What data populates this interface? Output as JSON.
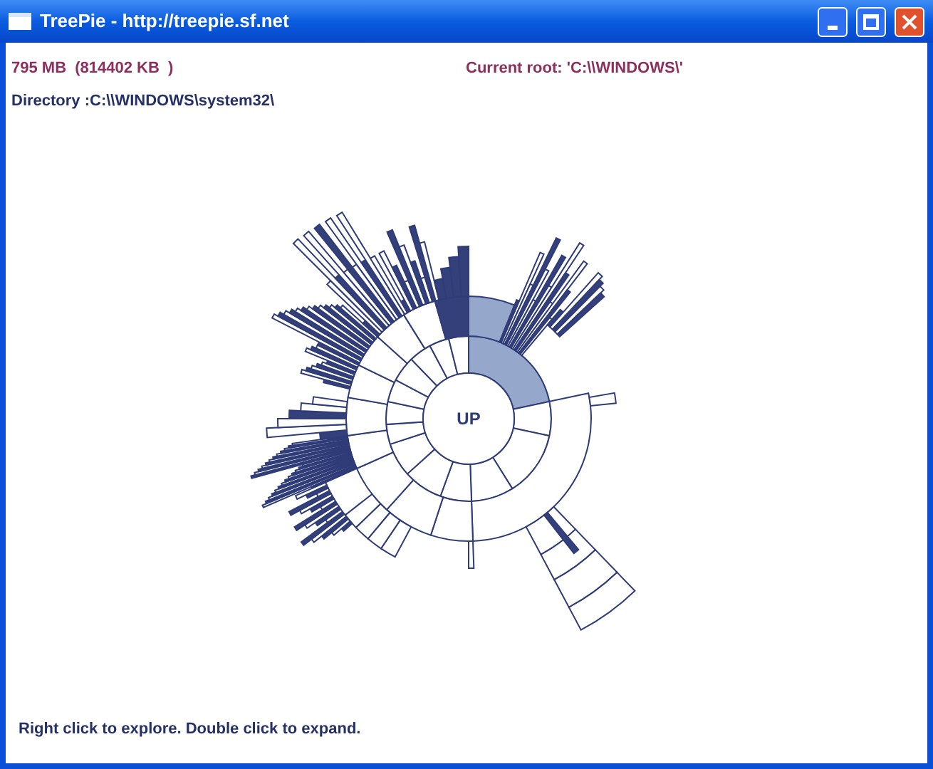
{
  "window": {
    "title": "TreePie - http://treepie.sf.net"
  },
  "header": {
    "size": "795 MB  (814402 KB  )",
    "current_root": "Current root: 'C:\\\\WINDOWS\\'",
    "directory": "Directory :C:\\\\WINDOWS\\system32\\"
  },
  "sunburst": {
    "center_label": "UP"
  },
  "status_hint": "Right click to explore. Double click to expand."
}
